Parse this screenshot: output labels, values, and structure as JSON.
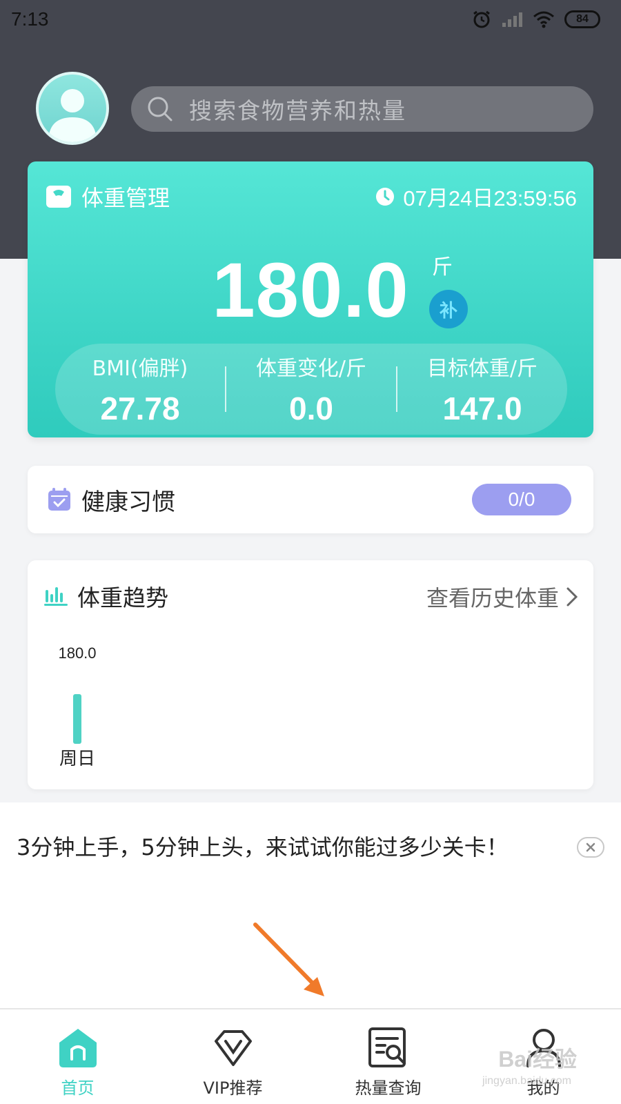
{
  "status_bar": {
    "time": "7:13",
    "battery": "84"
  },
  "search": {
    "placeholder": "搜索食物营养和热量"
  },
  "weight_card": {
    "title": "体重管理",
    "datetime": "07月24日23:59:56",
    "weight": "180.0",
    "unit": "斤",
    "supplement_label": "补",
    "stats": [
      {
        "label": "BMI(偏胖)",
        "value": "27.78"
      },
      {
        "label": "体重变化/斤",
        "value": "0.0"
      },
      {
        "label": "目标体重/斤",
        "value": "147.0"
      }
    ]
  },
  "habit_card": {
    "title": "健康习惯",
    "badge": "0/0"
  },
  "trend_card": {
    "title": "体重趋势",
    "link": "查看历史体重"
  },
  "chart_data": {
    "type": "bar",
    "categories": [
      "周日"
    ],
    "values": [
      180.0
    ],
    "data_labels": [
      "180.0"
    ],
    "color": "#4fd2c4"
  },
  "ad": {
    "text": "3分钟上手，5分钟上头，来试试你能过多少关卡！"
  },
  "tabbar": {
    "tabs": [
      {
        "label": "首页",
        "icon": "home-icon",
        "active": true
      },
      {
        "label": "VIP推荐",
        "icon": "vip-icon",
        "active": false
      },
      {
        "label": "热量查询",
        "icon": "calorie-search-icon",
        "active": false
      },
      {
        "label": "我的",
        "icon": "profile-icon",
        "active": false
      }
    ]
  },
  "watermark": {
    "text": "Bai经验",
    "sub": "jingyan.baidu.com"
  },
  "colors": {
    "accent": "#3fd2c4",
    "header": "#44464f",
    "badge": "#9c9ef0"
  }
}
